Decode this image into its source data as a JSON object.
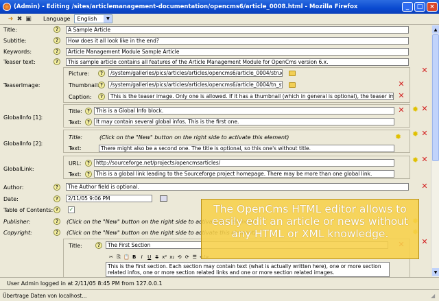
{
  "window": {
    "title": "(Admin) - Editing /sites/articlemanagement-documentation/opencms6/article_0008.html - Mozilla Firefox",
    "minimize": "_",
    "maximize": "□",
    "close": "×"
  },
  "toolbar": {
    "language_label": "Language",
    "language_value": "English",
    "icons": [
      "exit-icon",
      "save-exit-icon",
      "save-icon"
    ]
  },
  "form": {
    "title": {
      "label": "Title:",
      "value": "A Sample Article"
    },
    "subtitle": {
      "label": "Subtitle:",
      "value": "How does it all look like in the end?"
    },
    "keywords": {
      "label": "Keywords:",
      "value": "Article Management Module Sample Article"
    },
    "teaser_text": {
      "label": "Teaser text:",
      "value": "This sample article contains all features of the Article Management Module for OpenCms version 6.x."
    },
    "teaser_image": {
      "label": "TeaserImage:",
      "picture_label": "Picture:",
      "picture_value": "/system/galleries/pics/articles/articles/opencms6/article_0004/struct",
      "thumbnail_label": "Thumbnail:",
      "thumbnail_value": "/system/galleries/pics/articles/articles/opencms6/article_0004/tn_stru",
      "caption_label": "Caption:",
      "caption_value": "This is the teaser image. Only one is allowed. If it has a thumbnail (which in general is optional), the teaser image"
    },
    "globalinfo_1": {
      "label": "GlobalInfo [1]:",
      "title_label": "Title:",
      "title_value": "This is a Global Info block.",
      "text_label": "Text:",
      "text_value": "It may contain several global infos. This is the first one."
    },
    "globalinfo_2": {
      "label": "GlobalInfo [2]:",
      "title_label": "Title:",
      "hint": "(Click on the \"New\" button on the right side to activate this element)",
      "text_label": "Text:",
      "text_value": "There might also be a second one. The title is optional, so this one's without title."
    },
    "globallink": {
      "label": "GlobalLink:",
      "url_label": "URL:",
      "url_value": "http://sourceforge.net/projects/opencmsarticles/",
      "text_label": "Text:",
      "text_value": "This is a global link leading to the Sourceforge project homepage. There may be more than one global link."
    },
    "author": {
      "label": "Author:",
      "value": "The Author field is optional."
    },
    "date": {
      "label": "Date:",
      "value": "2/11/05 9:06 PM"
    },
    "toc": {
      "label": "Table of Contents:",
      "checked": "✓"
    },
    "publisher": {
      "label": "Publisher:",
      "hint": "(Click on the \"New\" button on the right side to activate this element)"
    },
    "copyright": {
      "label": "Copyright:",
      "hint": "(Click on the \"New\" button on the right side to activate this element)"
    },
    "section": {
      "title_label": "Title:",
      "title_value": "The First Section",
      "rte_buttons": [
        "✂",
        "⎘",
        "📋",
        "B",
        "I",
        "U",
        "S",
        "x²",
        "x₂",
        "⟲",
        "⟳",
        "☰",
        "</>"
      ],
      "body_value": "This is the first section. Each section may contain text (what is actually written here), one or more section related infos, one or more section related links and one or more section related images."
    }
  },
  "overlay": {
    "text": "The OpenCms HTML editor allows to easily edit an article or news without any HTML or XML knowledge."
  },
  "status": {
    "text": "User  Admin  logged in at  2/11/05 8:45 PM  from  127.0.0.1"
  },
  "browser_status": {
    "text": "Übertrage Daten von localhost..."
  },
  "colors": {
    "titlebar": "#0a4ad0",
    "delete": "#d21e1e",
    "new": "#e0c000",
    "overlay": "#f7d04a"
  }
}
